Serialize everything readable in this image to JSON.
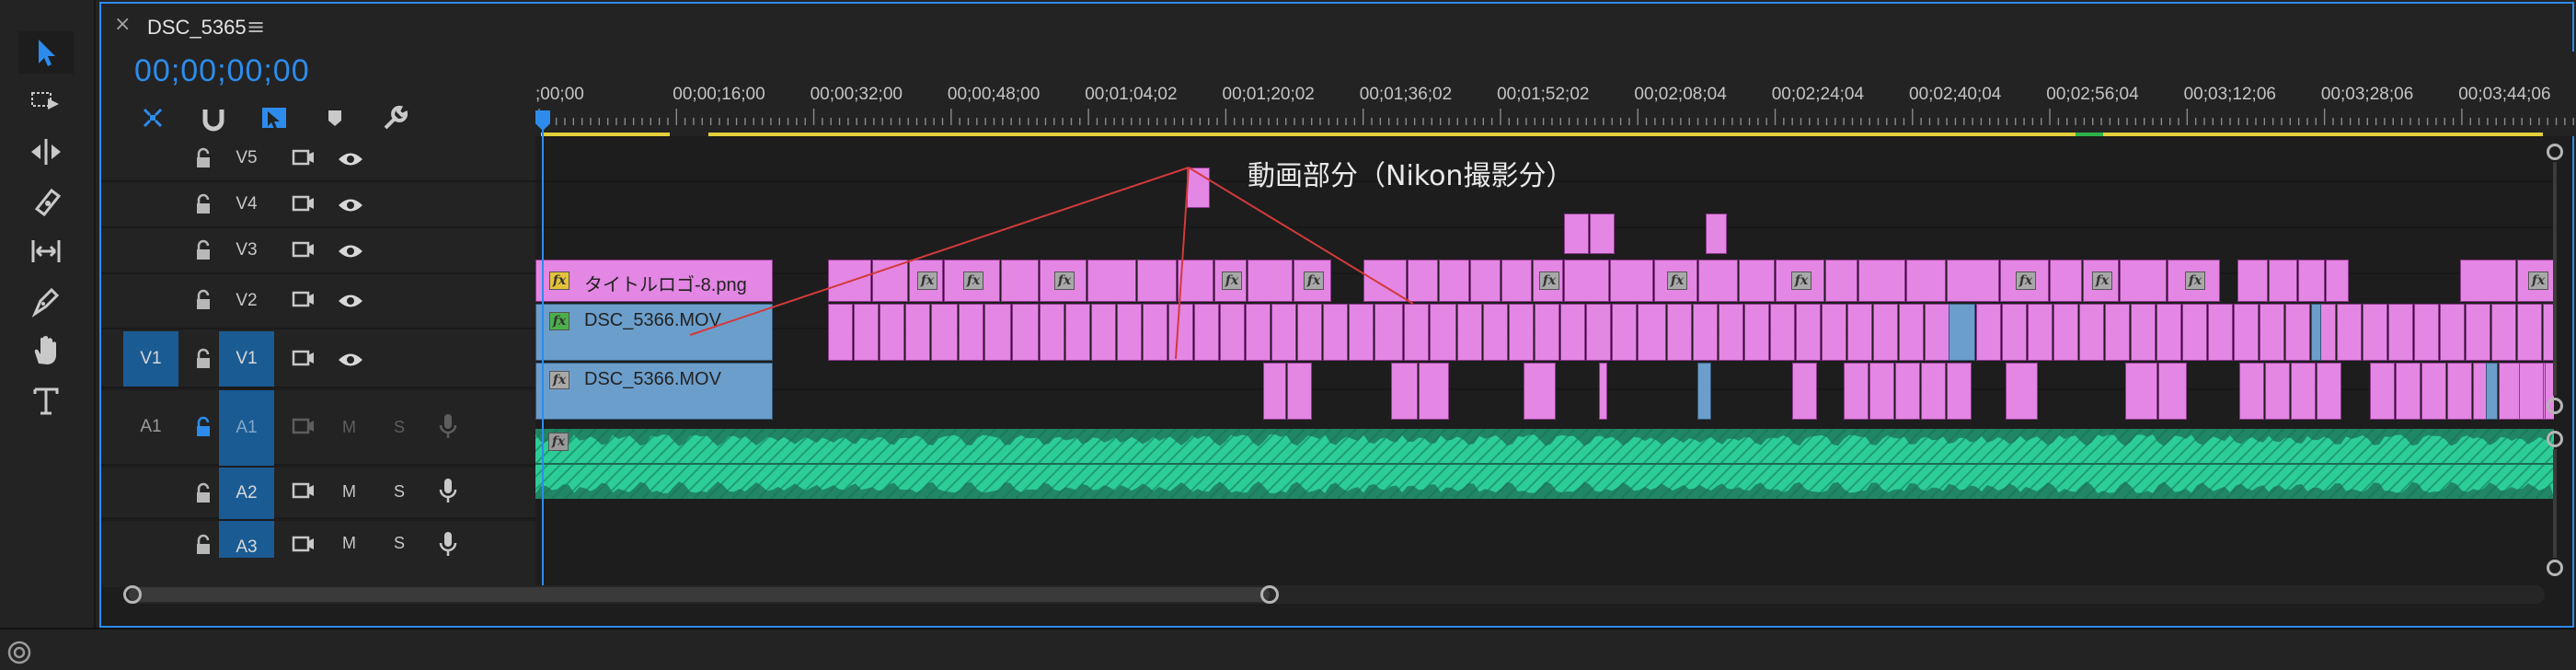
{
  "panel": {
    "title": "DSC_5365",
    "close_glyph": "×",
    "menu_glyph": "≡"
  },
  "timecode": "00;00;00;00",
  "ruler": {
    "labels": [
      ";00;00",
      "00;00;16;00",
      "00;00;32;00",
      "00;00;48;00",
      "00;01;04;02",
      "00;01;20;02",
      "00;01;36;02",
      "00;01;52;02",
      "00;02;08;04",
      "00;02;24;04",
      "00;02;40;04",
      "00;02;56;04",
      "00;03;12;06",
      "00;03;28;06",
      "00;03;44;06"
    ]
  },
  "tools": [
    "selection-tool-icon",
    "track-select-tool-icon",
    "ripple-edit-tool-icon",
    "razor-tool-icon",
    "slip-tool-icon",
    "pen-tool-icon",
    "hand-tool-icon",
    "type-tool-icon"
  ],
  "header_icons": [
    "insert-sequence-nest-icon",
    "snap-icon",
    "linked-selection-icon",
    "add-marker-icon",
    "wrench-icon"
  ],
  "video_tracks": [
    {
      "name": "V5",
      "source": ""
    },
    {
      "name": "V4",
      "source": ""
    },
    {
      "name": "V3",
      "source": ""
    },
    {
      "name": "V2",
      "source": ""
    },
    {
      "name": "V1",
      "source": "V1"
    }
  ],
  "audio_tracks": [
    {
      "name": "A1",
      "source": "A1",
      "mute": "M",
      "solo": "S"
    },
    {
      "name": "A2",
      "source": "",
      "mute": "M",
      "solo": "S"
    },
    {
      "name": "A3",
      "source": "",
      "mute": "M",
      "solo": "S"
    }
  ],
  "clips": {
    "title_clip": "タイトルロゴ-8.png",
    "v2_clip": "DSC_5366.MOV",
    "v1_clip": "DSC_5366.MOV"
  },
  "annotation": "動画部分（Nikon撮影分）",
  "colors": {
    "accent": "#2d8ceb",
    "video_clip": "#e486e4",
    "audio_clip": "#2dcd98",
    "blue_clip": "#6c9ecb",
    "yellow_bar": "#e2cf3a"
  }
}
